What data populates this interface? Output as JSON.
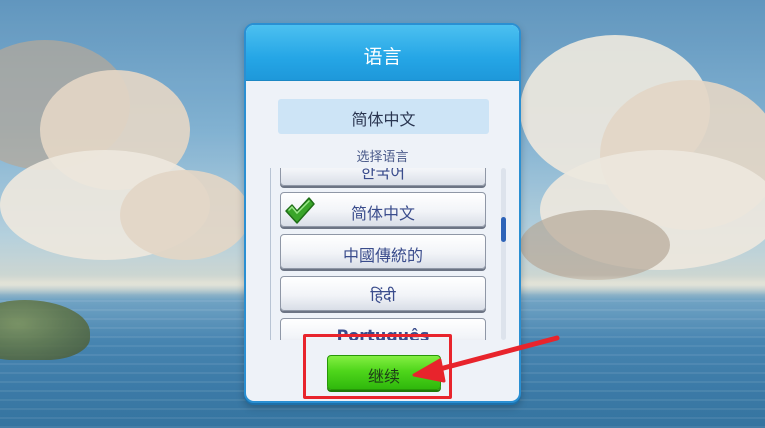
{
  "dialog": {
    "title": "语言",
    "current_language": "简体中文",
    "select_hint": "选择语言",
    "languages": [
      {
        "label": "한국어",
        "selected": false
      },
      {
        "label": "简体中文",
        "selected": true
      },
      {
        "label": "中國傳統的",
        "selected": false
      },
      {
        "label": "हिंदी",
        "selected": false
      },
      {
        "label": "Português",
        "selected": false
      }
    ],
    "scroll_position": 0.33,
    "continue_label": "继续"
  },
  "colors": {
    "header_blue": "#25a6e6",
    "continue_green": "#4fd61b",
    "check_green": "#3aa52a",
    "annotation_red": "#e8242c",
    "label_blue": "#3a4c8c"
  },
  "icons": {
    "check": "check-icon",
    "arrow": "arrow-pointer"
  }
}
